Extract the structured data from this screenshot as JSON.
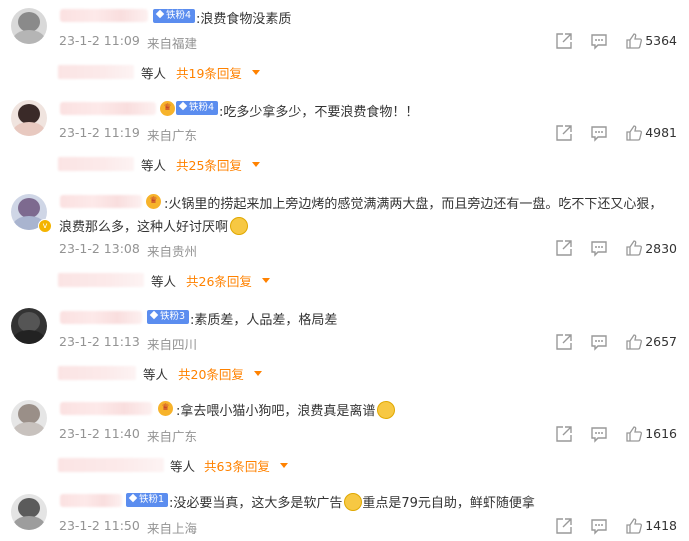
{
  "comments": [
    {
      "badge": "铁粉4",
      "text": ":浪费食物没素质",
      "time": "23-1-2 11:09",
      "location": "来自福建",
      "likes": "5364",
      "reply_people": "等人",
      "reply_count": "共19条回复"
    },
    {
      "badge": "铁粉4",
      "text": ":吃多少拿多少，不要浪费食物！！",
      "time": "23-1-2 11:19",
      "location": "来自广东",
      "likes": "4981",
      "reply_people": "等人",
      "reply_count": "共25条回复"
    },
    {
      "text_line1": ":火锅里的捞起来加上旁边烤的感觉满满两大盘，而且旁边还有一盘。吃不下还又心狠，",
      "text_line2": "浪费那么多，这种人好讨厌啊",
      "time": "23-1-2 13:08",
      "location": "来自贵州",
      "likes": "2830",
      "reply_people": "等人",
      "reply_count": "共26条回复"
    },
    {
      "badge": "铁粉3",
      "text": ":素质差，人品差，格局差",
      "time": "23-1-2 11:13",
      "location": "来自四川",
      "likes": "2657",
      "reply_people": "等人",
      "reply_count": "共20条回复"
    },
    {
      "text": ":拿去喂小猫小狗吧，浪费真是离谱",
      "time": "23-1-2 11:40",
      "location": "来自广东",
      "likes": "1616",
      "reply_people": "等人",
      "reply_count": "共63条回复"
    },
    {
      "badge": "铁粉1",
      "text_a": ":没必要当真，这大多是软广告",
      "text_b": "重点是79元自助，鲜虾随便拿",
      "time": "23-1-2 11:50",
      "location": "来自上海",
      "likes": "1418"
    }
  ],
  "colors": {
    "accent": "#ff8200",
    "fan_badge": "#5b8def",
    "meta": "#939393"
  },
  "icons": [
    "share-icon",
    "comment-icon",
    "like-icon"
  ]
}
